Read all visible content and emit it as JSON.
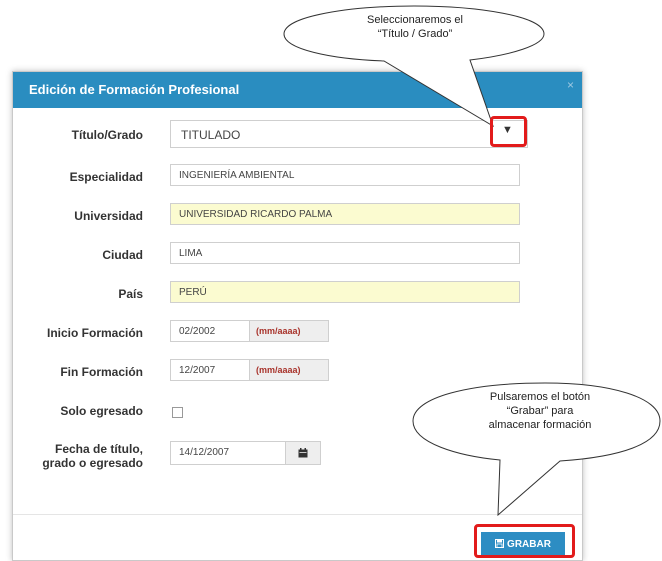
{
  "modal": {
    "title": "Edición de Formación Profesional",
    "close": "×"
  },
  "form": {
    "titulo_grado": {
      "label": "Título/Grado",
      "value": "TITULADO",
      "arrow": "▼"
    },
    "especialidad": {
      "label": "Especialidad",
      "value": "INGENIERÍA AMBIENTAL"
    },
    "universidad": {
      "label": "Universidad",
      "value": "UNIVERSIDAD RICARDO PALMA"
    },
    "ciudad": {
      "label": "Ciudad",
      "value": "LIMA"
    },
    "pais": {
      "label": "País",
      "value": "PERÚ"
    },
    "inicio": {
      "label": "Inicio Formación",
      "value": "02/2002",
      "hint": "(mm/aaaa)"
    },
    "fin": {
      "label": "Fin Formación",
      "value": "12/2007",
      "hint": "(mm/aaaa)"
    },
    "solo_egresado": {
      "label": "Solo egresado"
    },
    "fecha_titulo": {
      "label_line1": "Fecha de título,",
      "label_line2": "grado o egresado",
      "value": "14/12/2007"
    }
  },
  "footer": {
    "grabar_label": "GRABAR"
  },
  "callouts": {
    "top": {
      "line1": "Seleccionaremos el",
      "line2": "“Título / Grado”"
    },
    "bottom": {
      "line1": "Pulsaremos el botón",
      "line2": "“Grabar” para",
      "line3": "almacenar formación"
    }
  },
  "colors": {
    "header": "#2a8dc0",
    "button": "#2d8dc3",
    "highlight": "#e21b1b",
    "required_bg": "#fbfbd0"
  }
}
